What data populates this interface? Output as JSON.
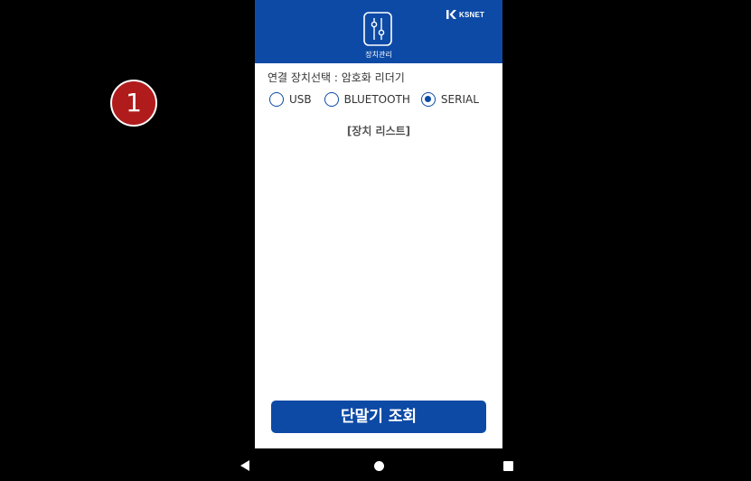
{
  "annotation": {
    "step_number": "1"
  },
  "header": {
    "caption": "장치관리",
    "icon": "sliders-icon",
    "brand": {
      "text": "KSNET",
      "icon": "ksnet-logo-icon"
    }
  },
  "device_select": {
    "label": "연결 장치선택 : 암호화 리더기",
    "options": [
      {
        "label": "USB",
        "checked": false
      },
      {
        "label": "BLUETOOTH",
        "checked": false
      },
      {
        "label": "SERIAL",
        "checked": true
      }
    ]
  },
  "device_list": {
    "title": "[장치 리스트]"
  },
  "actions": {
    "query_label": "단말기 조회"
  },
  "navbar": {
    "back_icon": "back-triangle-icon",
    "home_icon": "home-circle-icon",
    "recents_icon": "recents-square-icon"
  },
  "colors": {
    "primary": "#0d4aa6",
    "badge": "#b01c1c",
    "background": "#000000",
    "panel": "#ffffff"
  }
}
